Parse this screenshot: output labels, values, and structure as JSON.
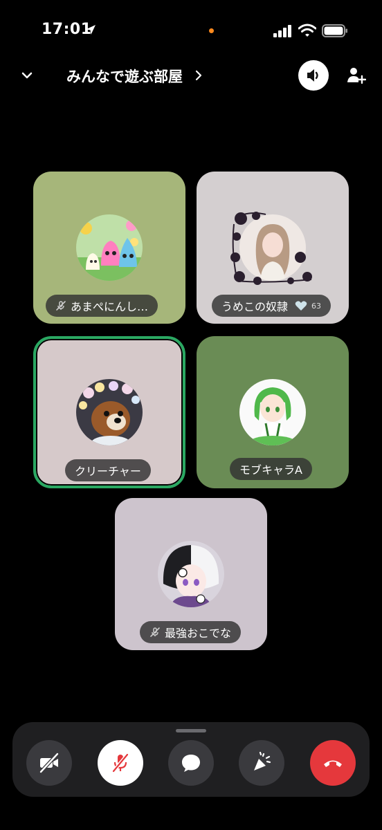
{
  "status_bar": {
    "time": "17:01",
    "icons": [
      "location-arrow-icon",
      "signal-icon",
      "wifi-icon",
      "battery-icon"
    ],
    "mic_indicator_color": "#ff8a1e"
  },
  "header": {
    "title": "みんなで遊ぶ部屋",
    "icons": [
      "chevron-down-icon",
      "chevron-right-icon",
      "speaker-icon",
      "add-user-icon"
    ]
  },
  "participants": [
    {
      "name": "あまぺにんし…",
      "muted": true,
      "tile_color": "#a6b67a",
      "speaking": false
    },
    {
      "name": "うめこの奴隷",
      "muted": false,
      "badge_count": "63",
      "tile_color": "#d4cfd0",
      "speaking": false
    },
    {
      "name": "クリーチャー",
      "muted": false,
      "tile_color": "#d6c9ca",
      "speaking": true,
      "speaking_color": "#2aa862"
    },
    {
      "name": "モブキャラA",
      "muted": false,
      "tile_color": "#6a8c55",
      "speaking": false
    },
    {
      "name": "最強おこでな",
      "muted": true,
      "tile_color": "#cdc4cd",
      "speaking": false
    }
  ],
  "controls": {
    "items": [
      "camera-off-icon",
      "mic-off-icon",
      "chat-icon",
      "activity-icon",
      "end-call-icon"
    ],
    "end_call_color": "#e5383c"
  }
}
